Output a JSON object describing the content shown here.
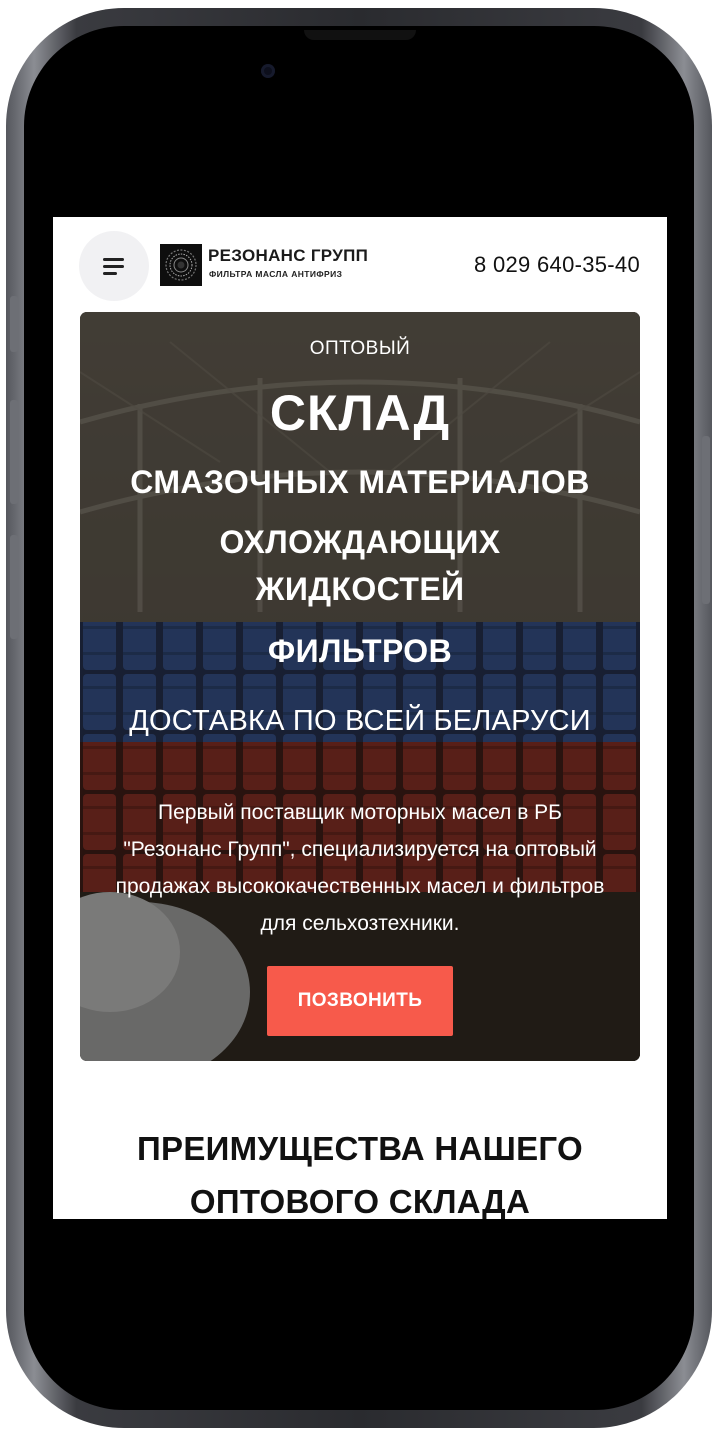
{
  "header": {
    "brand_name": "РЕЗОНАНС ГРУПП",
    "brand_tagline": "ФИЛЬТРА МАСЛА АНТИФРИЗ",
    "phone": "8 029 640-35-40",
    "menu_icon": "hamburger-menu-icon"
  },
  "hero": {
    "kicker": "ОПТОВЫЙ",
    "headline": "СКЛАД",
    "line1": "СМАЗОЧНЫХ МАТЕРИАЛОВ",
    "line2a": "ОХЛОЖДАЮЩИХ",
    "line2b": "ЖИДКОСТЕЙ",
    "line3": "ФИЛЬТРОВ",
    "delivery": "ДОСТАВКА ПО ВСЕЙ БЕЛАРУСИ",
    "description": "Первый поставщик моторных масел в РБ \"Резонанс Групп\", специализируется на оптовый продажах высококачественных масел и фильтров для сельхозтехники.",
    "cta_label": "ПОЗВОНИТЬ"
  },
  "advantages": {
    "title_line1": "ПРЕИМУЩЕСТВА НАШЕГО",
    "title_line2": "ОПТОВОГО СКЛАДА"
  },
  "colors": {
    "accent": "#f75a4b",
    "text_dark": "#111111",
    "hero_text": "#ffffff",
    "barrel_blue": "#2f4f8f",
    "barrel_red": "#8a2a22"
  }
}
